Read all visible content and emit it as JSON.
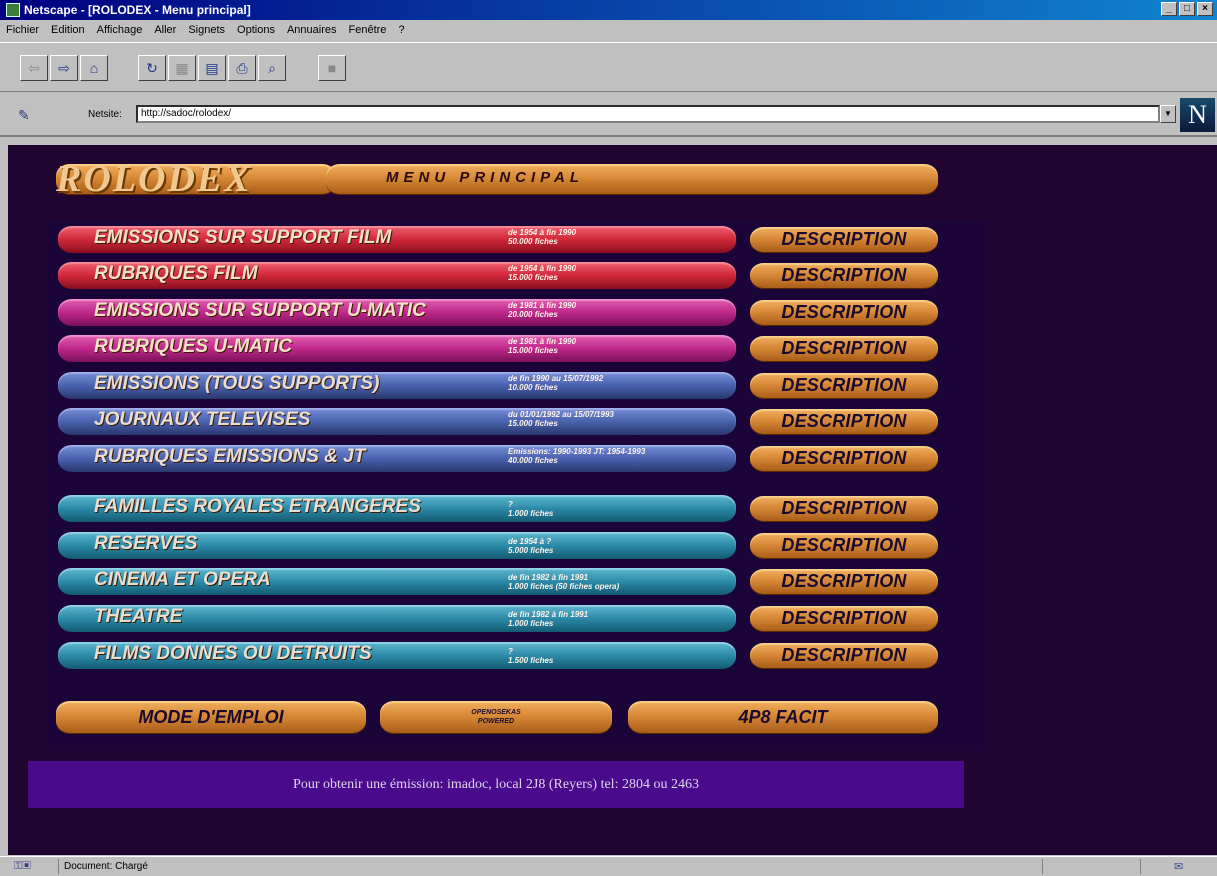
{
  "window": {
    "title": "Netscape - [ROLODEX - Menu principal]"
  },
  "menubar": [
    "Fichier",
    "Edition",
    "Affichage",
    "Aller",
    "Signets",
    "Options",
    "Annuaires",
    "Fenêtre",
    "?"
  ],
  "location": {
    "label": "Netsite:",
    "url": "http://sadoc/rolodex/"
  },
  "header": {
    "logo": "ROLODEX",
    "title": "MENU PRINCIPAL"
  },
  "description_label": "DESCRIPTION",
  "items": [
    {
      "label": "EMISSIONS SUR SUPPORT FILM",
      "info1": "de 1954 à fin 1990",
      "info2": "50.000 fiches"
    },
    {
      "label": "RUBRIQUES FILM",
      "info1": "de 1954 à fin 1990",
      "info2": "15.000 fiches"
    },
    {
      "label": "EMISSIONS SUR SUPPORT U-MATIC",
      "info1": "de 1981 à fin 1990",
      "info2": "20.000 fiches"
    },
    {
      "label": "RUBRIQUES U-MATIC",
      "info1": "de 1981 à fin 1990",
      "info2": "15.000 fiches"
    },
    {
      "label": "EMISSIONS (TOUS SUPPORTS)",
      "info1": "de fin 1990 au 15/07/1992",
      "info2": "10.000 fiches"
    },
    {
      "label": "JOURNAUX TELEVISES",
      "info1": "du 01/01/1992 au 15/07/1993",
      "info2": "15.000 fiches"
    },
    {
      "label": "RUBRIQUES EMISSIONS & JT",
      "info1": "Emissions: 1990-1993   JT: 1954-1993",
      "info2": "40.000 fiches"
    },
    {
      "label": "FAMILLES ROYALES ETRANGERES",
      "info1": "?",
      "info2": "1.000 fiches"
    },
    {
      "label": "RESERVES",
      "info1": "de 1954 à ?",
      "info2": "5.000 fiches"
    },
    {
      "label": "CINEMA ET OPERA",
      "info1": "de fin 1982 à fin 1991",
      "info2": "1.000 fiches (50 fiches opera)"
    },
    {
      "label": "THEATRE",
      "info1": "de fin 1982 à fin 1991",
      "info2": "1.000 fiches"
    },
    {
      "label": "FILMS DONNES OU DETRUITS",
      "info1": "?",
      "info2": "1.500 fiches"
    }
  ],
  "bottom": {
    "mode": "MODE D'EMPLOI",
    "mid1": "OPENOSEKAS",
    "mid2": "POWERED",
    "facit": "4P8 FACIT"
  },
  "footer": "Pour obtenir une émission: imadoc, local 2J8 (Reyers) tel: 2804 ou 2463",
  "status": {
    "text": "Document: Chargé"
  },
  "colors": {
    "orange": "#d98a38",
    "red": "#d0283a",
    "magenta": "#c0288a",
    "blue": "#4a62ae",
    "teal": "#2c8aa8",
    "background": "#1f0530",
    "footer": "#4a0a8c"
  }
}
